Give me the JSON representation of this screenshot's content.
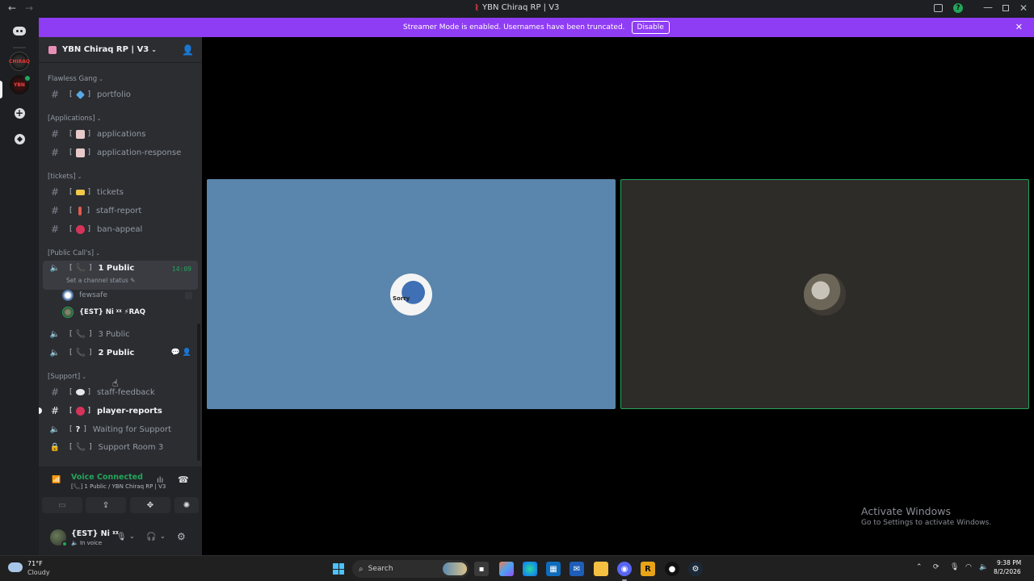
{
  "window": {
    "title": "YBN Chiraq RP | V3",
    "back": "←",
    "forward": "→",
    "minimize": "—",
    "close": "✕"
  },
  "rail": {
    "server1_label": "CHIRAQ",
    "server2_label": "YBN"
  },
  "banner": {
    "text": "Streamer Mode is enabled. Usernames have been truncated.",
    "button": "Disable",
    "close": "✕"
  },
  "server": {
    "name": "YBN Chiraq RP | V3",
    "chevron": "⌄"
  },
  "categories": [
    {
      "label": "Flawless Gang"
    },
    {
      "label": "[Applications]"
    },
    {
      "label": "[tickets]"
    },
    {
      "label": "[Public Call's]"
    },
    {
      "label": "[Support]"
    }
  ],
  "channels": {
    "portfolio": "portfolio",
    "applications": "applications",
    "application_response": "application-response",
    "tickets": "tickets",
    "staff_report": "staff-report",
    "ban_appeal": "ban-appeal",
    "public1": "1 Public",
    "public1_timer": "14:09",
    "public1_status": "Set a channel status ✎",
    "public3": "3 Public",
    "public2": "2 Public",
    "staff_feedback": "staff-feedback",
    "player_reports": "player-reports",
    "waiting_support": "Waiting for Support",
    "support_room3": "Support Room 3"
  },
  "voice_users": [
    {
      "name": "fewsafe"
    },
    {
      "name": "{EST} Ni ᵡᵡ ⚡RAQ"
    }
  ],
  "voice_panel": {
    "title": "Voice Connected",
    "subtitle": "[📞] 1 Public / YBN Chiraq RP | V3"
  },
  "user_panel": {
    "name": "{EST} Ni ᵡᵡ",
    "status": "🔈 In voice"
  },
  "stage": {
    "tile1_text": "Sorry",
    "watermark_title": "Activate Windows",
    "watermark_sub": "Go to Settings to activate Windows."
  },
  "taskbar": {
    "temp": "71°F",
    "condition": "Cloudy",
    "search_placeholder": "Search",
    "time": "9:38 PM",
    "date": "8/2/2026"
  },
  "colors": {
    "banner": "#8f3df4",
    "online": "#23a55a",
    "sidebar": "#2b2d31",
    "tile1": "#5a85ac",
    "tile2": "#2d2c29"
  }
}
